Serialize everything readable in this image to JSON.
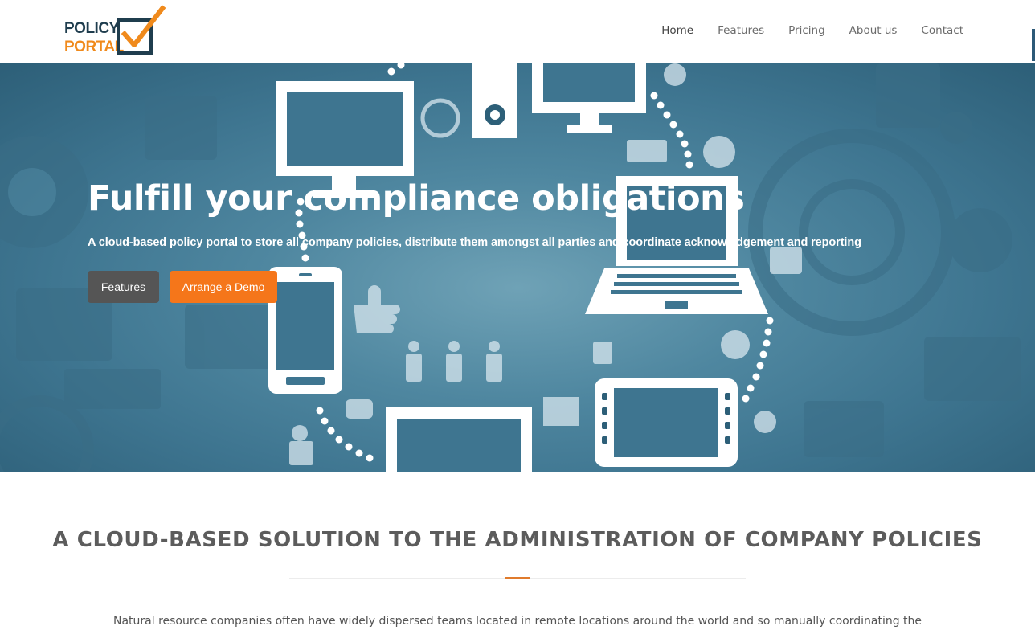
{
  "brand": {
    "line1": "POLICY",
    "line2": "PORTAL",
    "colors": {
      "dark": "#1f3d4e",
      "accent": "#f08a1c"
    }
  },
  "nav": {
    "items": [
      {
        "label": "Home",
        "active": true
      },
      {
        "label": "Features",
        "active": false
      },
      {
        "label": "Pricing",
        "active": false
      },
      {
        "label": "About us",
        "active": false
      },
      {
        "label": "Contact",
        "active": false
      }
    ]
  },
  "hero": {
    "title": "Fulfill your compliance obligations",
    "subtitle": "A cloud-based policy portal to store all company policies, distribute them amongst all parties and coordinate acknowledgement and reporting",
    "buttons": {
      "features": "Features",
      "demo": "Arrange a Demo"
    },
    "colors": {
      "features_button": "#555555",
      "demo_button": "#f5761a",
      "background": "#4f87a0"
    }
  },
  "section": {
    "title": "A CLOUD-BASED SOLUTION TO THE ADMINISTRATION OF COMPANY POLICIES",
    "paragraph": "Natural resource companies often have widely dispersed teams located in remote locations around the world and so manually coordinating the"
  }
}
